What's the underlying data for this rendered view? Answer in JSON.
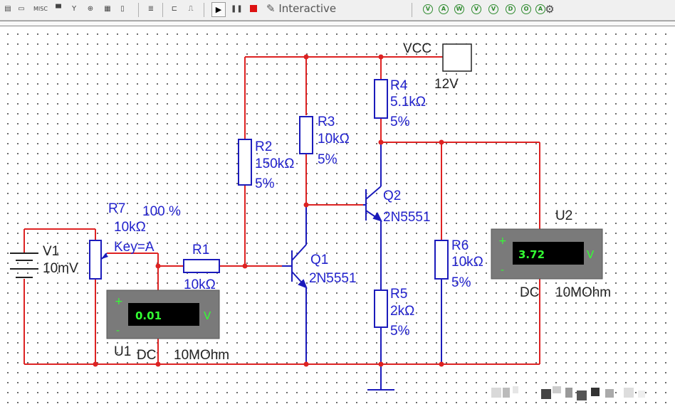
{
  "toolbar": {
    "misc_label": "MISC",
    "sim_label": "Interactive",
    "play_icon": "play-icon",
    "pause_icon": "pause-icon",
    "stop_icon": "stop-icon"
  },
  "colors": {
    "wire": "#dd2222",
    "component": "#1b1bbb",
    "meter_body": "#7a7a7a",
    "meter_display": "#000000",
    "meter_text": "#33ff33"
  },
  "components": {
    "vcc": {
      "name": "VCC",
      "value": "12V"
    },
    "v1": {
      "name": "V1",
      "value": "10mV"
    },
    "r1": {
      "name": "R1",
      "value": "10kΩ"
    },
    "r2": {
      "name": "R2",
      "value": "150kΩ",
      "tol": "5%"
    },
    "r3": {
      "name": "R3",
      "value": "10kΩ",
      "tol": "5%"
    },
    "r4": {
      "name": "R4",
      "value": "5.1kΩ",
      "tol": "5%"
    },
    "r5": {
      "name": "R5",
      "value": "2kΩ",
      "tol": "5%"
    },
    "r6": {
      "name": "R6",
      "value": "10kΩ",
      "tol": "5%"
    },
    "r7": {
      "name": "R7",
      "pct": "100 %",
      "value": "10kΩ",
      "key": "Key=A"
    },
    "q1": {
      "name": "Q1",
      "model": "2N5551"
    },
    "q2": {
      "name": "Q2",
      "model": "2N5551"
    }
  },
  "meters": {
    "u1": {
      "name": "U1",
      "reading": "0.01",
      "unit": "V",
      "mode": "DC",
      "impedance": "10MOhm",
      "plus": "+",
      "minus": "-"
    },
    "u2": {
      "name": "U2",
      "reading": "3.72",
      "unit": "V",
      "mode": "DC",
      "impedance": "10MOhm",
      "plus": "+",
      "minus": "-"
    }
  }
}
